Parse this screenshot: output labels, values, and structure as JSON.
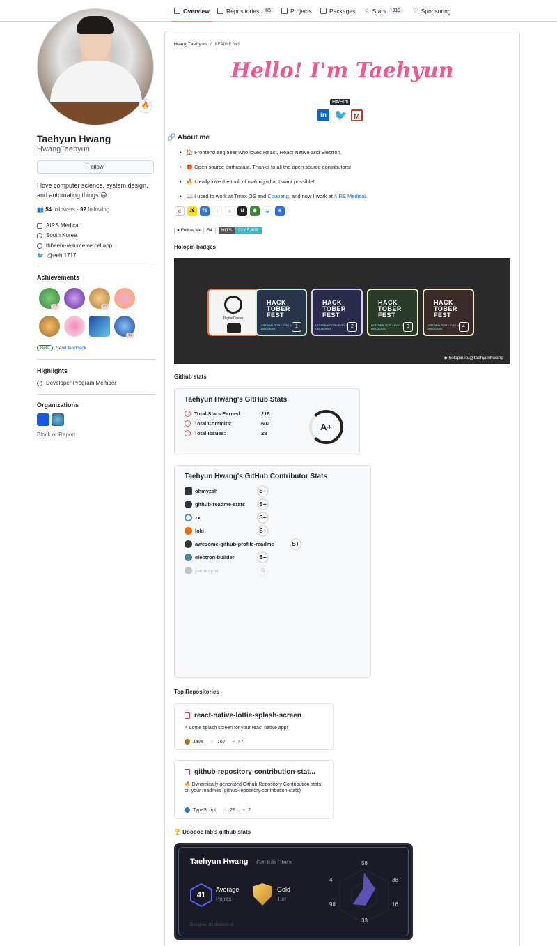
{
  "nav": {
    "tabs": [
      {
        "label": "Overview"
      },
      {
        "label": "Repositories",
        "count": "65"
      },
      {
        "label": "Projects"
      },
      {
        "label": "Packages"
      },
      {
        "label": "Stars",
        "count": "319"
      },
      {
        "label": "Sponsoring"
      }
    ]
  },
  "profile": {
    "name": "Taehyun Hwang",
    "login": "HwangTaehyun",
    "follow_label": "Follow",
    "bio": "I love computer science, system design, and automating things 😃",
    "followers": "54",
    "followers_label": "followers",
    "following": "92",
    "following_label": "following",
    "company": "AIRS Medical",
    "location": "South Korea",
    "website": "thbeem-resume.vercel.app",
    "twitter": "@eeht1717",
    "status_emoji": "🔥"
  },
  "achievements": {
    "title": "Achievements",
    "beta": "Beta",
    "feedback": "Send feedback",
    "x2": "x2"
  },
  "highlights": {
    "title": "Highlights",
    "item": "Developer Program Member"
  },
  "organizations": {
    "title": "Organizations",
    "block": "Block or Report"
  },
  "readme": {
    "crumb_user": "HwangTaehyun",
    "crumb_sep": "/",
    "crumb_file": "README.md",
    "hello": "Hello! I'm Taehyun",
    "pronoun": "He/Him",
    "about_title": "About me",
    "about": [
      "🏠 Frontend engineer who loves React, React Native and Electron.",
      "🎁 Open source enthusiast. Thanks to all the open source contributors!",
      "🔥 I really love the thrill of making what I want possible!",
      "📖 I used to work at Tmax OS and "
    ],
    "coupang": "Coupang",
    "about4_mid": ", and now I work at ",
    "airs": "AIRS Medical",
    "about4_end": ".",
    "follow_me": "Follow Me",
    "follow_count": "54",
    "hits_label": "HITS",
    "hits_value": "32 / 5,806",
    "holopin_title": "Holopin badges",
    "holopin_link": "holopin.io/@taehyunhwang",
    "digitalocean": "DigitalOcean",
    "hacktober": "HACK TOBER FEST",
    "hack_cards": [
      {
        "sub": "CONTRIBUTOR  LEVEL 1 · UNLOCKED",
        "n": "1"
      },
      {
        "sub": "CONTRIBUTOR  LEVEL 2 · UNLOCKED",
        "n": "2"
      },
      {
        "sub": "CONTRIBUTOR  LEVEL 3 · UNLOCKED",
        "n": "3"
      },
      {
        "sub": "CONTRIBUTOR  LEVEL 4 · UNLOCKED",
        "n": "4"
      }
    ],
    "gh_title": "Github stats",
    "stats_title": "Taehyun Hwang's GitHub Stats",
    "stats": [
      {
        "label": "Total Stars Earned:",
        "value": "218"
      },
      {
        "label": "Total Commits:",
        "value": "602"
      },
      {
        "label": "Total Issues:",
        "value": "28"
      }
    ],
    "grade": "A+",
    "contrib_title": "Taehyun Hwang's GitHub Contributor Stats",
    "contrib": [
      {
        "name": "ohmyzsh",
        "rank": "S+"
      },
      {
        "name": "github-readme-stats",
        "rank": "S+"
      },
      {
        "name": "zx",
        "rank": "S+"
      },
      {
        "name": "loki",
        "rank": "S+"
      },
      {
        "name": "awesome-github-profile-readme",
        "rank": "S+"
      },
      {
        "name": "electron-builder",
        "rank": "S+"
      },
      {
        "name": "jsencrypt",
        "rank": "S"
      }
    ],
    "top_title": "Top Repositories",
    "repos": [
      {
        "name": "react-native-lottie-splash-screen",
        "desc": "⚡ Lottie splash screen for your react native app!",
        "lang": "Java",
        "stars": "167",
        "forks": "47"
      },
      {
        "name": "github-repository-contribution-stat...",
        "desc": "🔥 Dynamically generated Github Repository Contribution stats on your readmes (github-repository-contribution-stats)",
        "lang": "TypeScript",
        "stars": "28",
        "forks": "2"
      }
    ],
    "dooboo_title": "🏆 Dooboo lab's github stats",
    "dooboo": {
      "name": "Taehyun Hwang",
      "sub": "GitHub Stats",
      "avg": "41",
      "avg_label": "Average",
      "avg_sub": "Points",
      "tier": "Gold",
      "tier_sub": "Tier",
      "footer": "Designed by dooboo.io",
      "radar": [
        "58",
        "38",
        "16",
        "33",
        "98",
        "4"
      ]
    }
  },
  "colors": {
    "accent": "#fd8c73",
    "link": "#0969da",
    "hello": "#ee5a8f",
    "java": "#b07219",
    "ts": "#3178c6"
  }
}
